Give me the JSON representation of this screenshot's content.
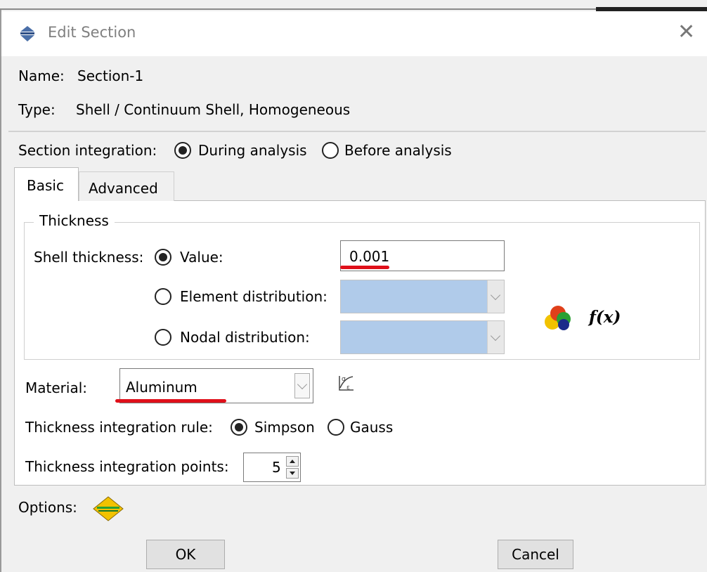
{
  "dialog": {
    "title": "Edit Section"
  },
  "section": {
    "name_label": "Name:",
    "name_value": "Section-1",
    "type_label": "Type:",
    "type_value": "Shell / Continuum Shell, Homogeneous",
    "integration_label": "Section integration:",
    "integration_options": [
      "During analysis",
      "Before analysis"
    ],
    "integration_selected": "During analysis"
  },
  "tabs": [
    {
      "label": "Basic",
      "selected": true
    },
    {
      "label": "Advanced",
      "selected": false
    }
  ],
  "thickness": {
    "group_label": "Thickness",
    "shell_label": "Shell thickness:",
    "value_option": "Value:",
    "value": "0.001",
    "element_option": "Element distribution:",
    "nodal_option": "Nodal distribution:",
    "selected": "Value:",
    "fx_label": "f(x)"
  },
  "material": {
    "label": "Material:",
    "value": "Aluminum"
  },
  "integration_rule": {
    "label": "Thickness integration rule:",
    "options": [
      "Simpson",
      "Gauss"
    ],
    "selected": "Simpson"
  },
  "integration_points": {
    "label": "Thickness integration points:",
    "value": "5"
  },
  "options": {
    "label": "Options:"
  },
  "buttons": {
    "ok": "OK",
    "cancel": "Cancel"
  },
  "colors": {
    "annotation_red": "#e0101a",
    "disabled_combo": "#b0cbea"
  }
}
